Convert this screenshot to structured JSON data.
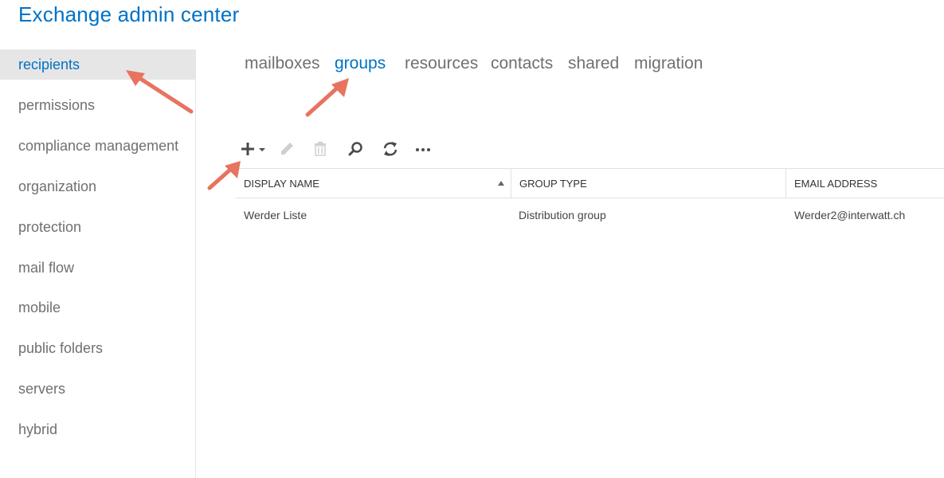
{
  "app": {
    "title": "Exchange admin center"
  },
  "sidebar": {
    "items": [
      {
        "label": "recipients",
        "active": true
      },
      {
        "label": "permissions"
      },
      {
        "label": "compliance management"
      },
      {
        "label": "organization"
      },
      {
        "label": "protection"
      },
      {
        "label": "mail flow"
      },
      {
        "label": "mobile"
      },
      {
        "label": "public folders"
      },
      {
        "label": "servers"
      },
      {
        "label": "hybrid"
      }
    ]
  },
  "tabs": [
    {
      "label": "mailboxes"
    },
    {
      "label": "groups",
      "active": true
    },
    {
      "label": "resources"
    },
    {
      "label": "contacts"
    },
    {
      "label": "shared"
    },
    {
      "label": "migration"
    }
  ],
  "toolbar": {
    "icons": [
      "add-icon",
      "edit-icon",
      "delete-icon",
      "search-icon",
      "refresh-icon",
      "more-icon"
    ]
  },
  "table": {
    "columns": [
      "DISPLAY NAME",
      "GROUP TYPE",
      "EMAIL ADDRESS"
    ],
    "sort_column": "DISPLAY NAME",
    "sort_direction": "ascending",
    "rows": [
      {
        "display_name": "Werder Liste",
        "group_type": "Distribution group",
        "email": "Werder2@interwatt.ch"
      }
    ]
  },
  "colors": {
    "accent": "#0072c6",
    "annotation_arrow": "#e8735f",
    "sidebar_active_bg": "#e6e6e6",
    "muted_text": "#707070"
  }
}
